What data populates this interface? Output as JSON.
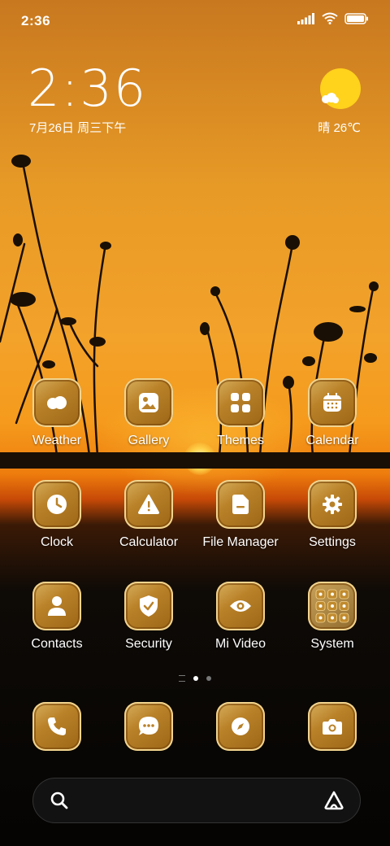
{
  "status_bar": {
    "time": "2:36"
  },
  "clock_widget": {
    "time": "2:36",
    "date": "7月26日 周三下午"
  },
  "weather_widget": {
    "text": "晴 26℃"
  },
  "apps": [
    {
      "label": "Weather",
      "icon": "weather-icon"
    },
    {
      "label": "Gallery",
      "icon": "gallery-icon"
    },
    {
      "label": "Themes",
      "icon": "themes-icon"
    },
    {
      "label": "Calendar",
      "icon": "calendar-icon"
    },
    {
      "label": "Clock",
      "icon": "clock-icon"
    },
    {
      "label": "Calculator",
      "icon": "calculator-icon"
    },
    {
      "label": "File Manager",
      "icon": "file-manager-icon"
    },
    {
      "label": "Settings",
      "icon": "settings-icon"
    },
    {
      "label": "Contacts",
      "icon": "contacts-icon"
    },
    {
      "label": "Security",
      "icon": "security-icon"
    },
    {
      "label": "Mi Video",
      "icon": "mi-video-icon"
    },
    {
      "label": "System",
      "icon": "system-folder-icon"
    }
  ],
  "dock": [
    {
      "icon": "phone-icon"
    },
    {
      "icon": "messages-icon"
    },
    {
      "icon": "browser-icon"
    },
    {
      "icon": "camera-icon"
    }
  ],
  "colors": {
    "icon_gold": "#b98128",
    "sun": "#ffd21c"
  }
}
